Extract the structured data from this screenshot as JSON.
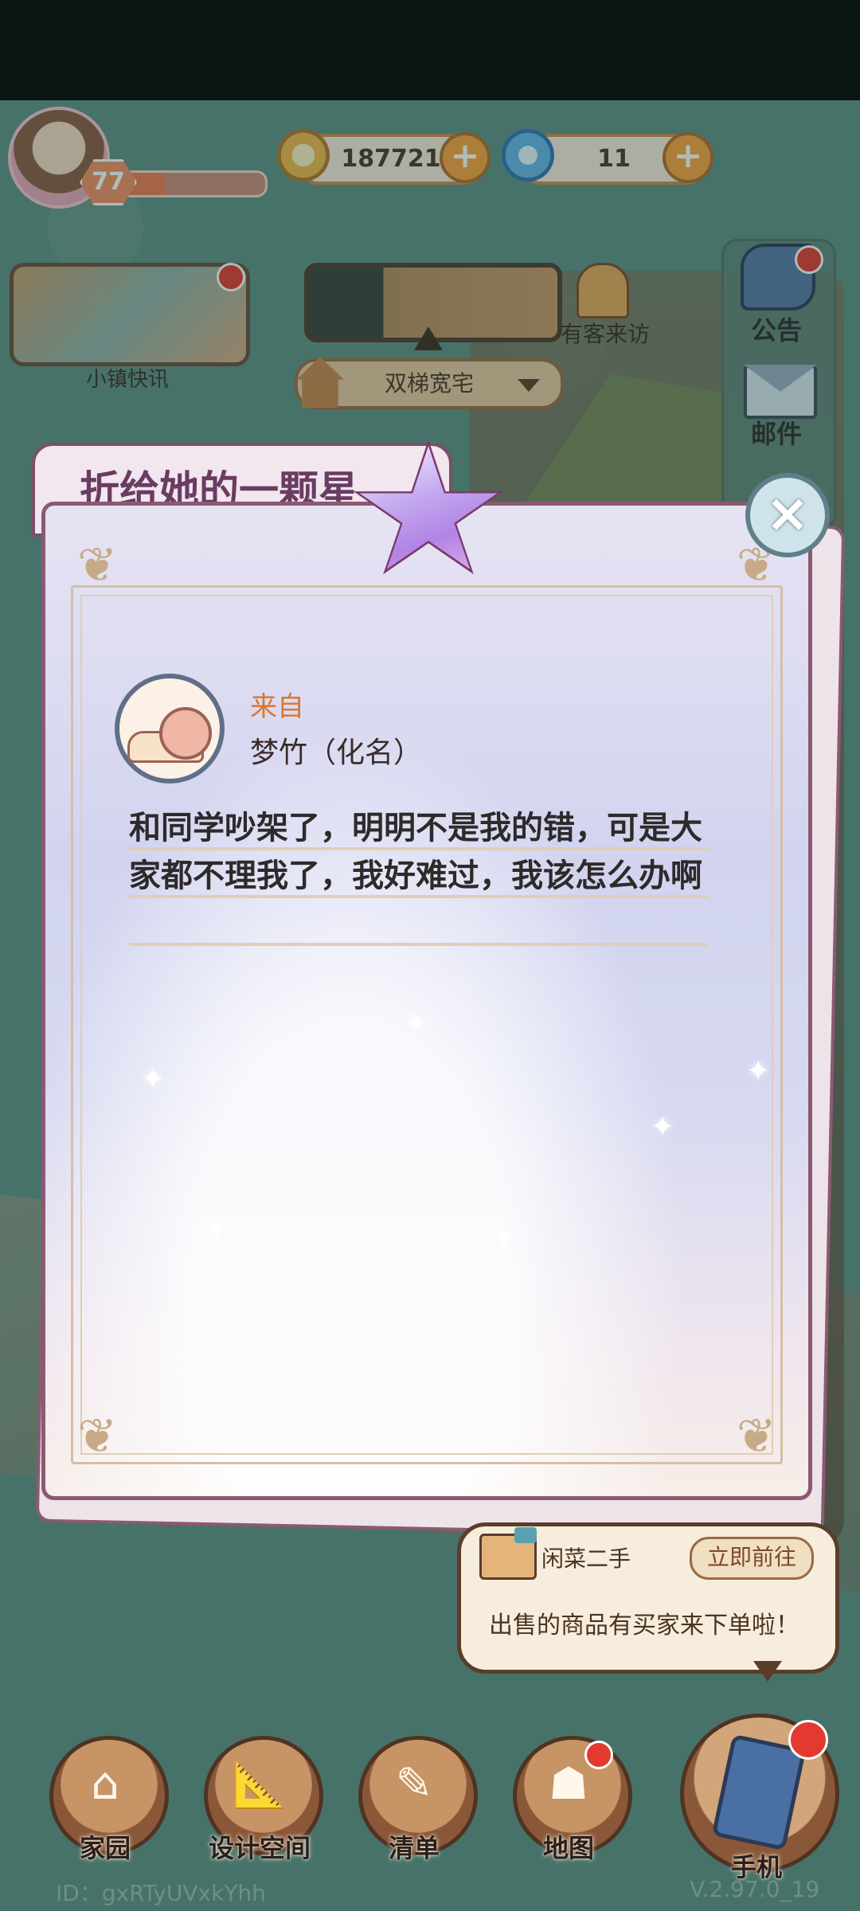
{
  "hud": {
    "level": "77",
    "xp_progress": 0.3,
    "coins": "187721",
    "gems": "11"
  },
  "left": {
    "news_label": "小镇快讯"
  },
  "center": {
    "house_name": "双梯宽宅",
    "visitor_label": "有客来访"
  },
  "side": {
    "notice_label": "公告",
    "mail_label": "邮件"
  },
  "card": {
    "title": "折给她的一颗星",
    "from_label": "来自",
    "from_name": "梦竹（化名）",
    "message": "和同学吵架了，明明不是我的错，可是大家都不理我了，我好难过，我该怎么办啊"
  },
  "notification": {
    "title": "闲菜二手",
    "button": "立即前往",
    "message": "出售的商品有买家来下单啦！"
  },
  "nav": [
    {
      "label": "家园"
    },
    {
      "label": "设计空间"
    },
    {
      "label": "清单"
    },
    {
      "label": "地图"
    },
    {
      "label": "手机"
    }
  ],
  "footer": {
    "id": "ID：gxRTyUVxkYhh",
    "version": "V.2.97.0_19"
  },
  "colors": {
    "background": "#5f8f85",
    "accent_orange": "#f7a43d",
    "title_purple": "#6a3c62",
    "alert_red": "#e23a2e"
  }
}
